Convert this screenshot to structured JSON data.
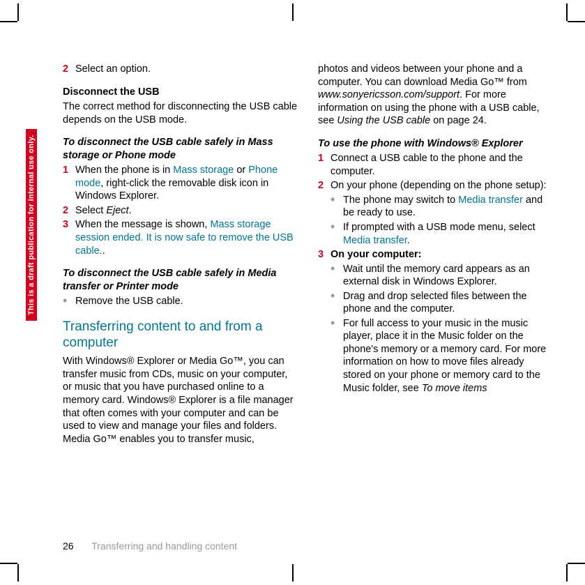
{
  "draft_label": "This is a draft publication for internal use only.",
  "col1": {
    "step2": {
      "num": "2",
      "text": "Select an option."
    },
    "h_disconnect_usb": "Disconnect the USB",
    "disconnect_intro": "The correct method for disconnecting the USB cable depends on the USB mode.",
    "h_disconnect_mass": "To disconnect the USB cable safely in Mass storage or Phone mode",
    "mass1": {
      "num": "1",
      "pre": "When the phone is in ",
      "t1": "Mass storage",
      "mid": " or ",
      "t2": "Phone mode",
      "post": ", right-click the removable disk icon in Windows Explorer."
    },
    "mass2": {
      "num": "2",
      "pre": "Select ",
      "i": "Eject",
      "post": "."
    },
    "mass3": {
      "num": "3",
      "pre": "When the message is shown, ",
      "t": "Mass storage session ended. It is now safe to remove the USB cable.",
      "post": "."
    },
    "h_disconnect_media": "To disconnect the USB cable safely in Media transfer or Printer mode",
    "media_bullet": "Remove the USB cable.",
    "section_title": "Transferring content to and from a computer",
    "section_body": "With Windows® Explorer or Media Go™, you can transfer music from CDs, music on your computer, or music that you have purchased online to a memory card. Windows® Explorer is a file manager that often comes with your computer and can be used to view and manage your files and folders. Media Go™ enables you to transfer music,"
  },
  "col2": {
    "continuation_pre": "photos and videos between your phone and a computer. You can download Media Go™ from ",
    "continuation_i1": "www.sonyericsson.com/support",
    "continuation_mid": ". For more information on using the phone with a USB cable, see ",
    "continuation_i2": "Using the USB cable",
    "continuation_post": " on page 24.",
    "h_explorer": "To use the phone with Windows® Explorer",
    "s1": {
      "num": "1",
      "text": "Connect a USB cable to the phone and the computer."
    },
    "s2": {
      "num": "2",
      "text": "On your phone (depending on the phone setup):"
    },
    "s2b1": {
      "pre": "The phone may switch to ",
      "t": "Media transfer",
      "post": " and be ready to use."
    },
    "s2b2": {
      "pre": "If prompted with a USB mode menu, select ",
      "t": "Media transfer",
      "post": "."
    },
    "s3": {
      "num": "3",
      "text": "On your computer:"
    },
    "s3b1": "Wait until the memory card appears as an external disk in Windows Explorer.",
    "s3b2": "Drag and drop selected files between the phone and the computer.",
    "s3b3_pre": "For full access to your music in the music player, place it in the Music folder on the phone's memory or a memory card. For more information on how to move files already stored on your phone or memory card to the Music folder, see ",
    "s3b3_i": "To move items"
  },
  "footer": {
    "page_num": "26",
    "title": "Transferring and handling content"
  }
}
